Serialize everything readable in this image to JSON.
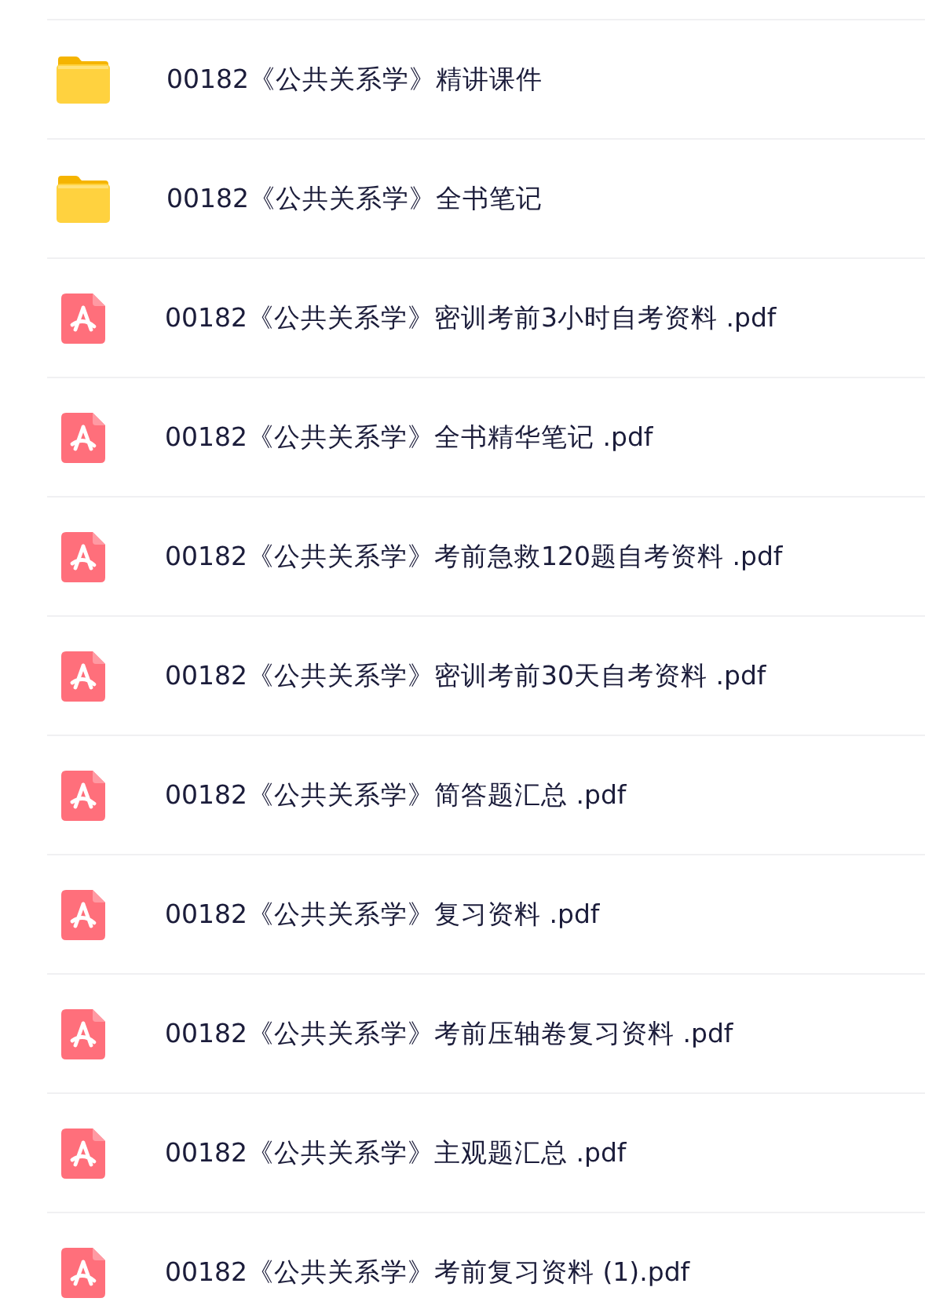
{
  "files": [
    {
      "kind": "folder",
      "name": "00182《公共关系学》精讲课件"
    },
    {
      "kind": "folder",
      "name": "00182《公共关系学》全书笔记"
    },
    {
      "kind": "pdf",
      "name": "00182《公共关系学》密训考前3小时自考资料 .pdf"
    },
    {
      "kind": "pdf",
      "name": "00182《公共关系学》全书精华笔记 .pdf"
    },
    {
      "kind": "pdf",
      "name": "00182《公共关系学》考前急救120题自考资料 .pdf"
    },
    {
      "kind": "pdf",
      "name": "00182《公共关系学》密训考前30天自考资料 .pdf"
    },
    {
      "kind": "pdf",
      "name": "00182《公共关系学》简答题汇总 .pdf"
    },
    {
      "kind": "pdf",
      "name": "00182《公共关系学》复习资料 .pdf"
    },
    {
      "kind": "pdf",
      "name": "00182《公共关系学》考前压轴卷复习资料 .pdf"
    },
    {
      "kind": "pdf",
      "name": "00182《公共关系学》主观题汇总 .pdf"
    },
    {
      "kind": "pdf",
      "name": "00182《公共关系学》考前复习资料 (1).pdf"
    }
  ]
}
